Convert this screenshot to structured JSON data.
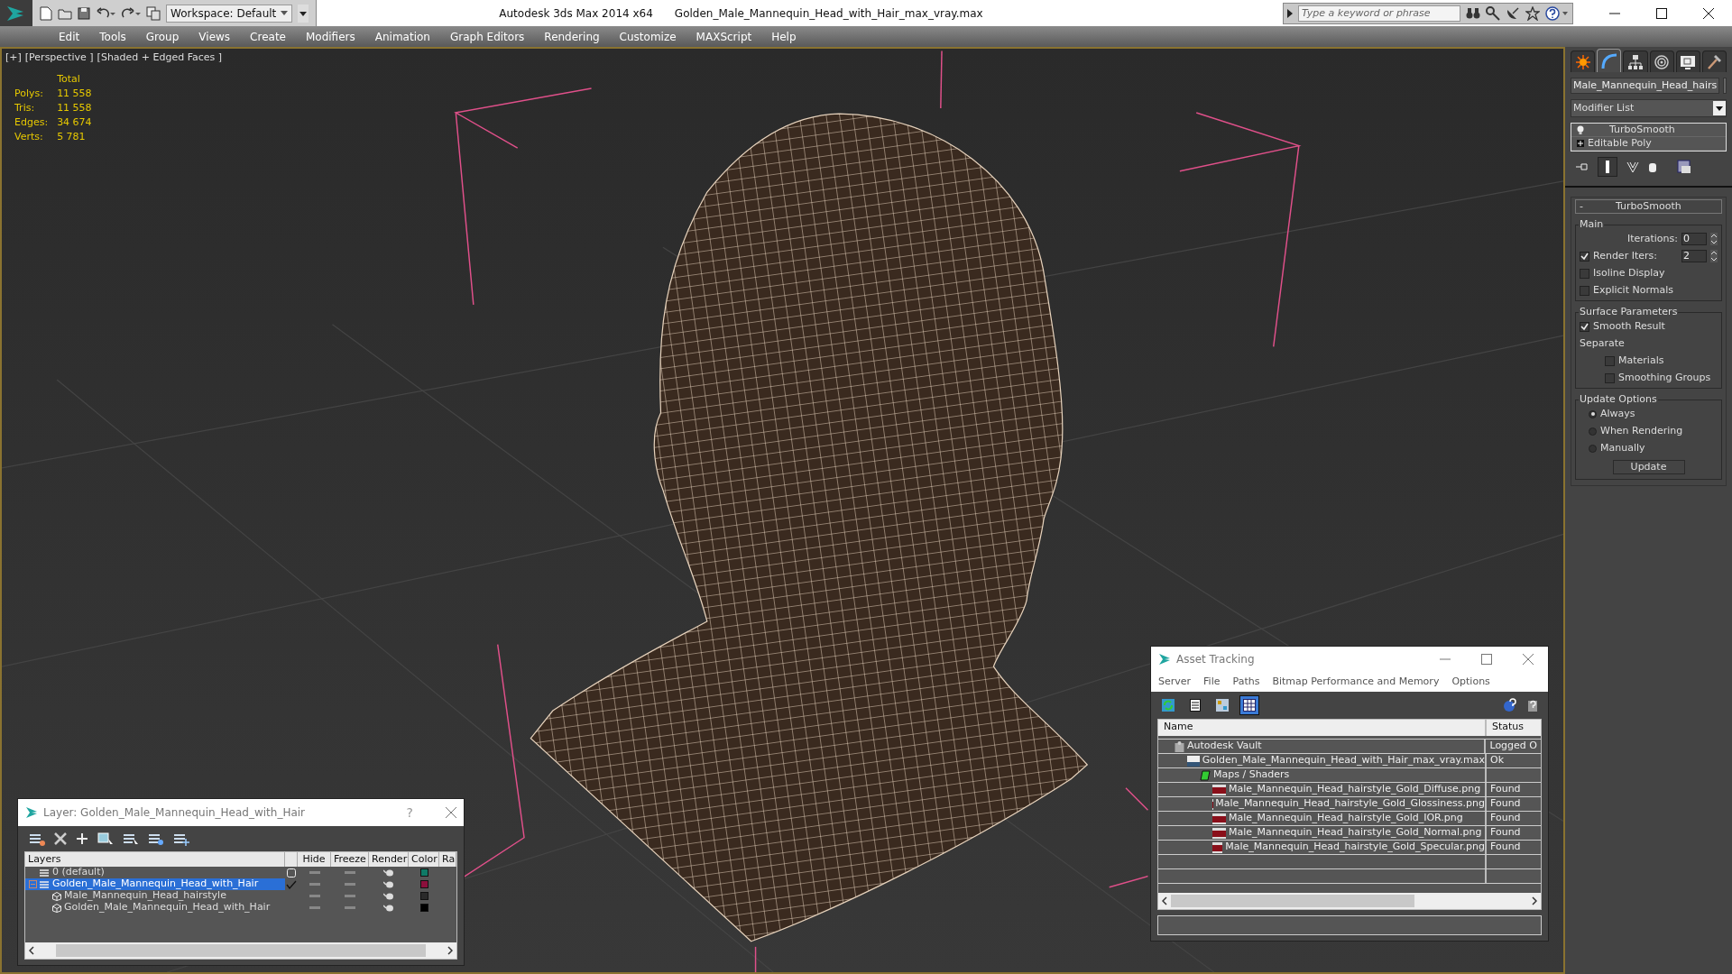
{
  "title_bar": {
    "app_title": "Autodesk 3ds Max  2014 x64",
    "file_name": "Golden_Male_Mannequin_Head_with_Hair_max_vray.max",
    "workspace": "Workspace: Default",
    "search": {
      "placeholder": "Type a keyword or phrase"
    }
  },
  "menu": [
    "Edit",
    "Tools",
    "Group",
    "Views",
    "Create",
    "Modifiers",
    "Animation",
    "Graph Editors",
    "Rendering",
    "Customize",
    "MAXScript",
    "Help"
  ],
  "viewport": {
    "labels": [
      "[+]",
      "[Perspective ]",
      "[Shaded + Edged Faces ]"
    ],
    "stats_header": "Total",
    "stats": [
      {
        "label": "Polys:",
        "value": "11 558"
      },
      {
        "label": "Tris:",
        "value": "11 558"
      },
      {
        "label": "Edges:",
        "value": "34 674"
      },
      {
        "label": "Verts:",
        "value": "5 781"
      }
    ]
  },
  "command_panel": {
    "tabs": [
      {
        "kind": "create",
        "selected": false
      },
      {
        "kind": "modify",
        "selected": true
      },
      {
        "kind": "hierarchy",
        "selected": false
      },
      {
        "kind": "motion",
        "selected": false
      },
      {
        "kind": "display",
        "selected": false
      },
      {
        "kind": "utilities",
        "selected": false
      }
    ],
    "object_name": "Male_Mannequin_Head_hairs",
    "modifier_list": "Modifier List",
    "stack": [
      {
        "kind": "modifier",
        "label": "TurboSmooth"
      },
      {
        "kind": "base",
        "label": "Editable Poly"
      }
    ],
    "rollout": {
      "sign": "-",
      "title": "TurboSmooth",
      "groups": [
        {
          "title": "Main",
          "rows": [
            {
              "kind": "spinner",
              "label": "Iterations:",
              "value": "0"
            },
            {
              "kind": "checked_spinner",
              "label": "Render Iters:",
              "value": "2",
              "checked": true
            },
            {
              "kind": "checkbox",
              "label": "Isoline Display",
              "checked": false
            },
            {
              "kind": "checkbox",
              "label": "Explicit Normals",
              "checked": false
            }
          ]
        },
        {
          "title": "Surface Parameters",
          "rows": [
            {
              "kind": "checkbox",
              "label": "Smooth Result",
              "checked": true
            },
            {
              "kind": "label",
              "label": "Separate"
            },
            {
              "kind": "subcheckbox",
              "label": "Materials",
              "checked": false
            },
            {
              "kind": "subcheckbox",
              "label": "Smoothing Groups",
              "checked": false
            }
          ]
        },
        {
          "title": "Update Options",
          "rows": [
            {
              "kind": "radio",
              "label": "Always",
              "selected": true
            },
            {
              "kind": "radio",
              "label": "When Rendering",
              "selected": false
            },
            {
              "kind": "radio",
              "label": "Manually",
              "selected": false
            },
            {
              "kind": "button",
              "label": "Update"
            }
          ]
        }
      ]
    }
  },
  "layer_window": {
    "title": "Layer: Golden_Male_Mannequin_Head_with_Hair",
    "help": "?",
    "columns": [
      "Layers",
      "Hide",
      "Freeze",
      "Render",
      "Color",
      "Ra"
    ],
    "rows": [
      {
        "kind": "layer",
        "name": "0 (default)",
        "current": false,
        "selected": false,
        "color": "#0e7a66"
      },
      {
        "kind": "layer",
        "name": "Golden_Male_Mannequin_Head_with_Hair",
        "current": true,
        "selected": true,
        "expanded": true,
        "color": "#8c0f3c",
        "children": [
          {
            "kind": "object",
            "name": "Male_Mannequin_Head_hairstyle",
            "selected": false,
            "color": "#2a2a2a"
          },
          {
            "kind": "object",
            "name": "Golden_Male_Mannequin_Head_with_Hair",
            "selected": false,
            "color": "#000000"
          }
        ]
      }
    ]
  },
  "asset_window": {
    "title": "Asset Tracking",
    "menu": [
      "Server",
      "File",
      "Paths",
      "Bitmap Performance and Memory",
      "Options"
    ],
    "toolbar": [
      {
        "kind": "refresh",
        "selected": false
      },
      {
        "kind": "list",
        "selected": false
      },
      {
        "kind": "thumbnails",
        "selected": false
      },
      {
        "kind": "table",
        "selected": true
      }
    ],
    "columns": [
      "Name",
      "Status"
    ],
    "rows": [
      {
        "kind": "vault",
        "name": "Autodesk Vault",
        "status": "Logged O",
        "children": [
          {
            "kind": "max",
            "name": "Golden_Male_Mannequin_Head_with_Hair_max_vray.max",
            "status": "Ok",
            "children": [
              {
                "kind": "folder",
                "name": "Maps / Shaders",
                "children": [
                  {
                    "kind": "png",
                    "name": "Male_Mannequin_Head_hairstyle_Gold_Diffuse.png",
                    "status": "Found"
                  },
                  {
                    "kind": "png",
                    "name": "Male_Mannequin_Head_hairstyle_Gold_Glossiness.png",
                    "status": "Found"
                  },
                  {
                    "kind": "png",
                    "name": "Male_Mannequin_Head_hairstyle_Gold_IOR.png",
                    "status": "Found"
                  },
                  {
                    "kind": "png",
                    "name": "Male_Mannequin_Head_hairstyle_Gold_Normal.png",
                    "status": "Found"
                  },
                  {
                    "kind": "png",
                    "name": "Male_Mannequin_Head_hairstyle_Gold_Specular.png",
                    "status": "Found"
                  }
                ]
              }
            ]
          }
        ]
      }
    ]
  }
}
